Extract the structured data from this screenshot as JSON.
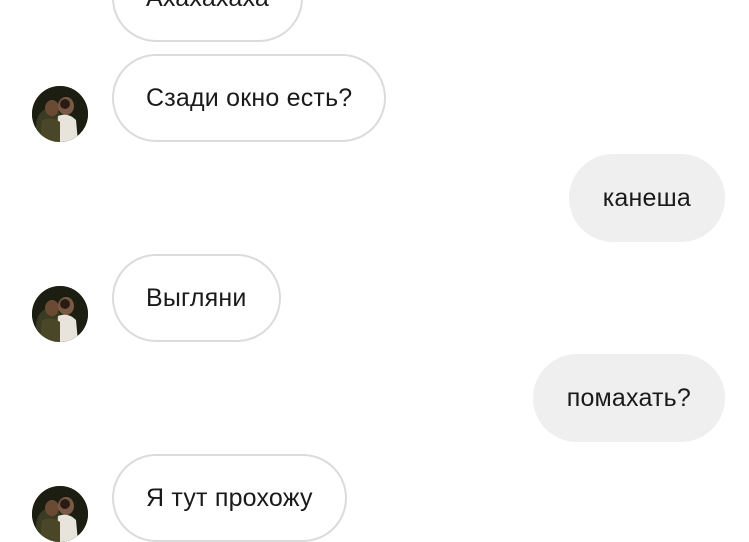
{
  "thread": {
    "messages": [
      {
        "id": "m1",
        "direction": "incoming",
        "text": "Ахахахаха",
        "has_avatar": false
      },
      {
        "id": "m2",
        "direction": "incoming",
        "text": "Сзади окно есть?",
        "has_avatar": true
      },
      {
        "id": "m3",
        "direction": "outgoing",
        "text": "канеша"
      },
      {
        "id": "m4",
        "direction": "incoming",
        "text": "Выгляни",
        "has_avatar": true
      },
      {
        "id": "m5",
        "direction": "outgoing",
        "text": "помахать?"
      },
      {
        "id": "m6",
        "direction": "incoming",
        "text": "Я тут прохожу",
        "has_avatar": true
      }
    ]
  },
  "colors": {
    "incoming_border": "#dbdbdb",
    "outgoing_bg": "#efefef",
    "text": "#1a1a1a"
  },
  "icons": {
    "avatar": "contact-avatar-photo"
  }
}
